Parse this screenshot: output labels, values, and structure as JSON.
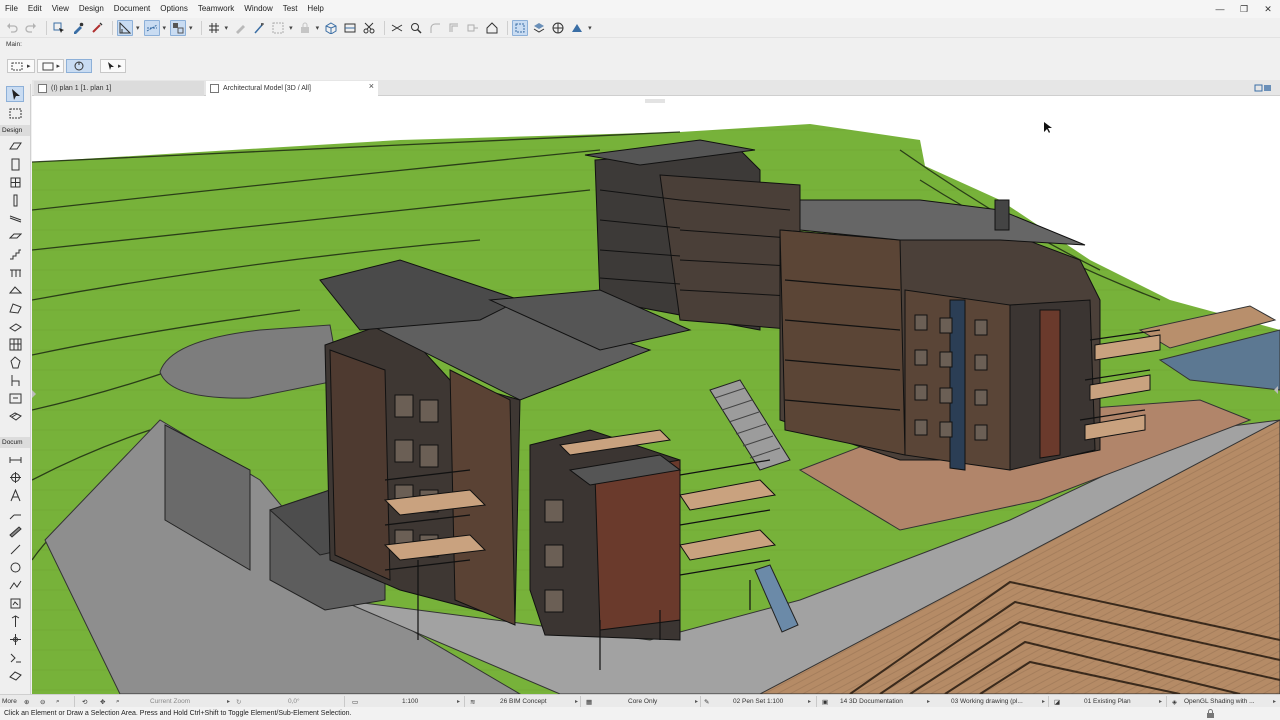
{
  "menu": [
    "File",
    "Edit",
    "View",
    "Design",
    "Document",
    "Options",
    "Teamwork",
    "Window",
    "Test",
    "Help"
  ],
  "window_controls": {
    "minimize": "—",
    "maximize": "❐",
    "close": "✕"
  },
  "info_box": {
    "label": "Main:"
  },
  "tabs": [
    {
      "label": "(I) plan 1 [1. plan 1]"
    },
    {
      "label": "Architectural Model [3D / All]",
      "close": "×"
    }
  ],
  "toolbox": {
    "design_header": "Design",
    "document_header": "Docum",
    "more": "More"
  },
  "status_bar": {
    "zoom_placeholder": "Current Zoom",
    "rotation": "0,0°",
    "scale": "1:100",
    "layer_combo": "26 BIM Concept",
    "structure": "Core Only",
    "pen_set": "02 Pen Set 1:100",
    "mvo": "14 3D Documentation",
    "renovation": "03 Working drawing (pl...",
    "plan_filter": "01 Existing Plan",
    "engine": "OpenGL Shading with ..."
  },
  "hint": "Click an Element or Draw a Selection Area. Press and Hold Ctrl+Shift to Toggle Element/Sub-Element Selection.",
  "colors": {
    "selection": "#c9dcf2",
    "terrain": "#78b43c",
    "wood_deck": "#b9906c",
    "water": "#5c7892",
    "facade_dark": "#3b3532",
    "facade_brown": "#5a4034",
    "roof": "#666666"
  },
  "icons": {
    "toolbar": [
      "undo",
      "redo",
      "arrow-select",
      "eyedropper",
      "pencil",
      "layout",
      "snap",
      "guide",
      "grid",
      "marquee",
      "magic",
      "3d-view",
      "section",
      "wall",
      "slab",
      "roof",
      "mesh"
    ],
    "status": [
      "zoom-in",
      "zoom-out",
      "fit",
      "orbit",
      "pan",
      "zoom-window"
    ]
  }
}
